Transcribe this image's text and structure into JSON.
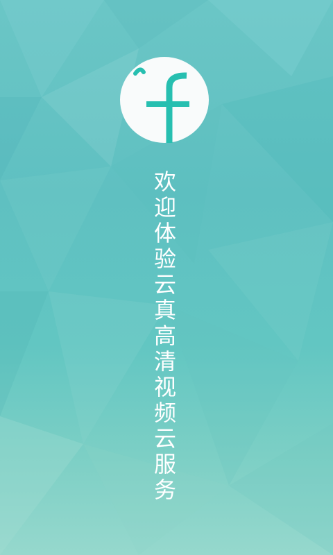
{
  "splash": {
    "logo_letter": "f",
    "welcome_text": "欢迎体验云真高清视频云服务",
    "colors": {
      "accent": "#27bfb0",
      "logo_bg": "#f9fbfb",
      "text": "#ffffff",
      "bg_top": "#6bc6c6",
      "bg_bottom": "#96d8cd"
    }
  }
}
